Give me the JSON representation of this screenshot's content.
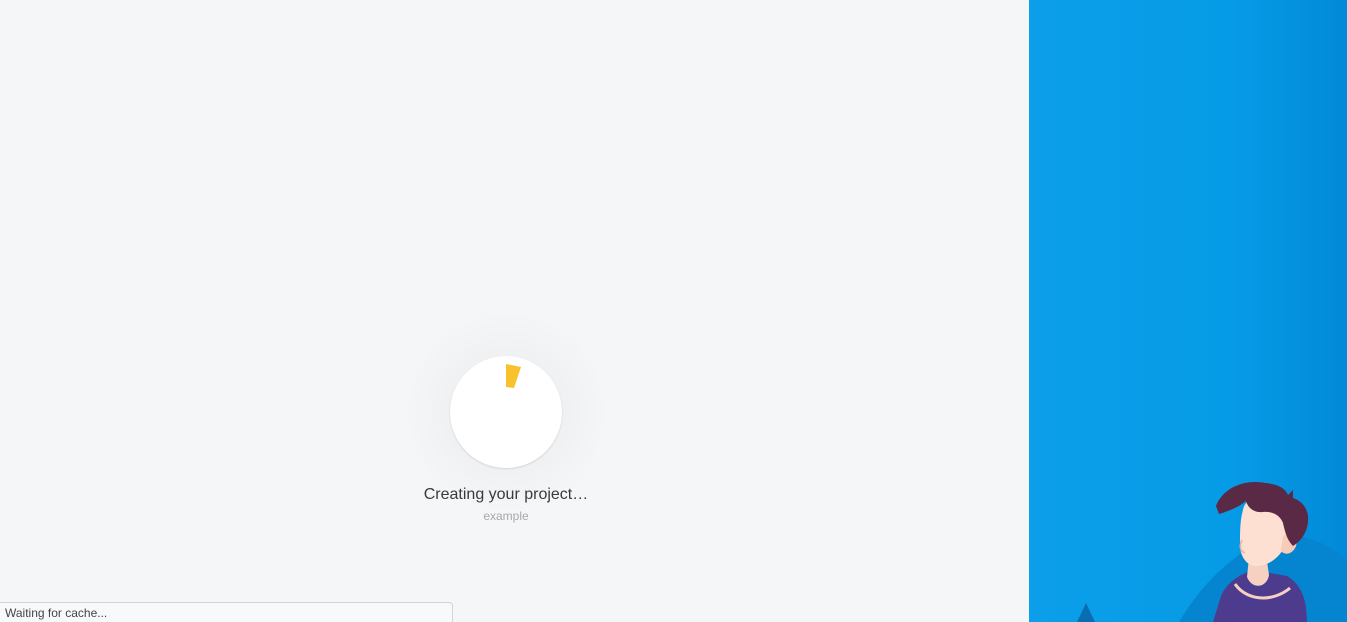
{
  "loading": {
    "title": "Creating your project…",
    "subtitle": "example",
    "spinner_color": "#f8c22f"
  },
  "browser": {
    "status_text": "Waiting for cache..."
  },
  "colors": {
    "background": "#f5f6f8",
    "art_blue": "#0699e6",
    "hair": "#5a2945",
    "skin": "#fde0d2",
    "shirt": "#4d3b8d"
  },
  "illustration": {
    "name": "person-illustration"
  }
}
